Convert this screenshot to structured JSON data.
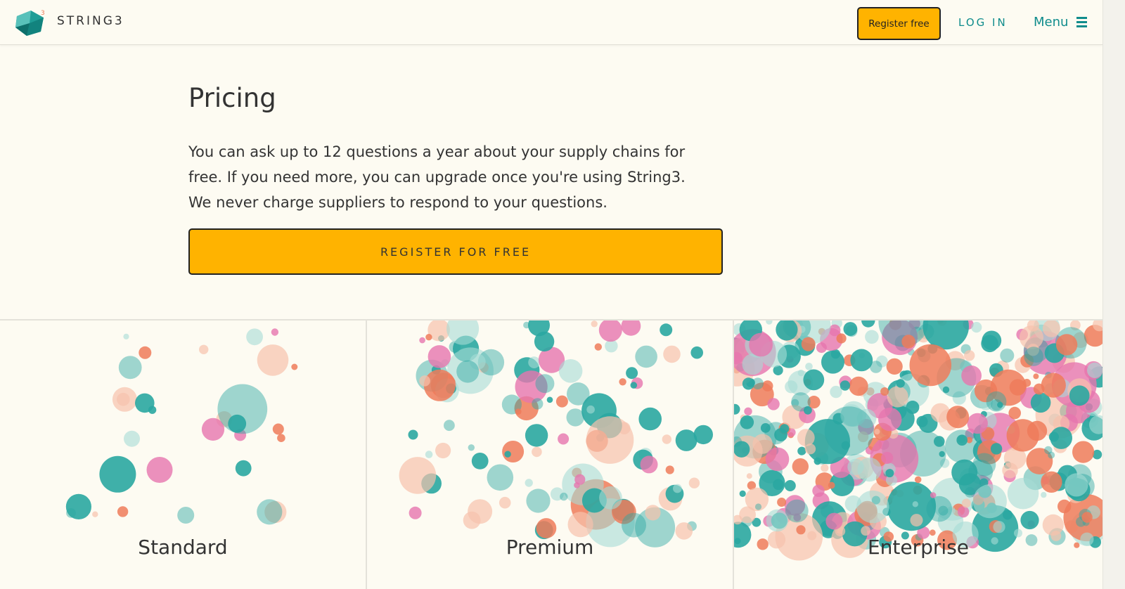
{
  "brand": {
    "name": "STRING3",
    "superscript": "3"
  },
  "nav": {
    "register_label": "Register free",
    "login_label": "LOG IN",
    "menu_label": "Menu"
  },
  "main": {
    "title": "Pricing",
    "paragraph_lines": [
      "You can ask up to 12 questions a year about your supply chains for",
      "free. If you need more, you can upgrade once you're using String3.",
      "We never charge suppliers to respond to your questions."
    ],
    "cta_label": "REGISTER FOR FREE"
  },
  "tiers": [
    {
      "label": "Standard",
      "density": 30
    },
    {
      "label": "Premium",
      "density": 110
    },
    {
      "label": "Enterprise",
      "density": 420
    }
  ],
  "colors": {
    "accent": "#ffb300",
    "teal": "#0f8c8c",
    "bubble_teal": "#2aa7a1",
    "bubble_coral": "#ef7b5a",
    "bubble_pink": "#e675ae",
    "bubble_peach": "#f7c2ad",
    "bubble_mint": "#a6dcd6"
  },
  "icons": {
    "logo": "string3-cube-logo",
    "menu": "hamburger-icon"
  }
}
